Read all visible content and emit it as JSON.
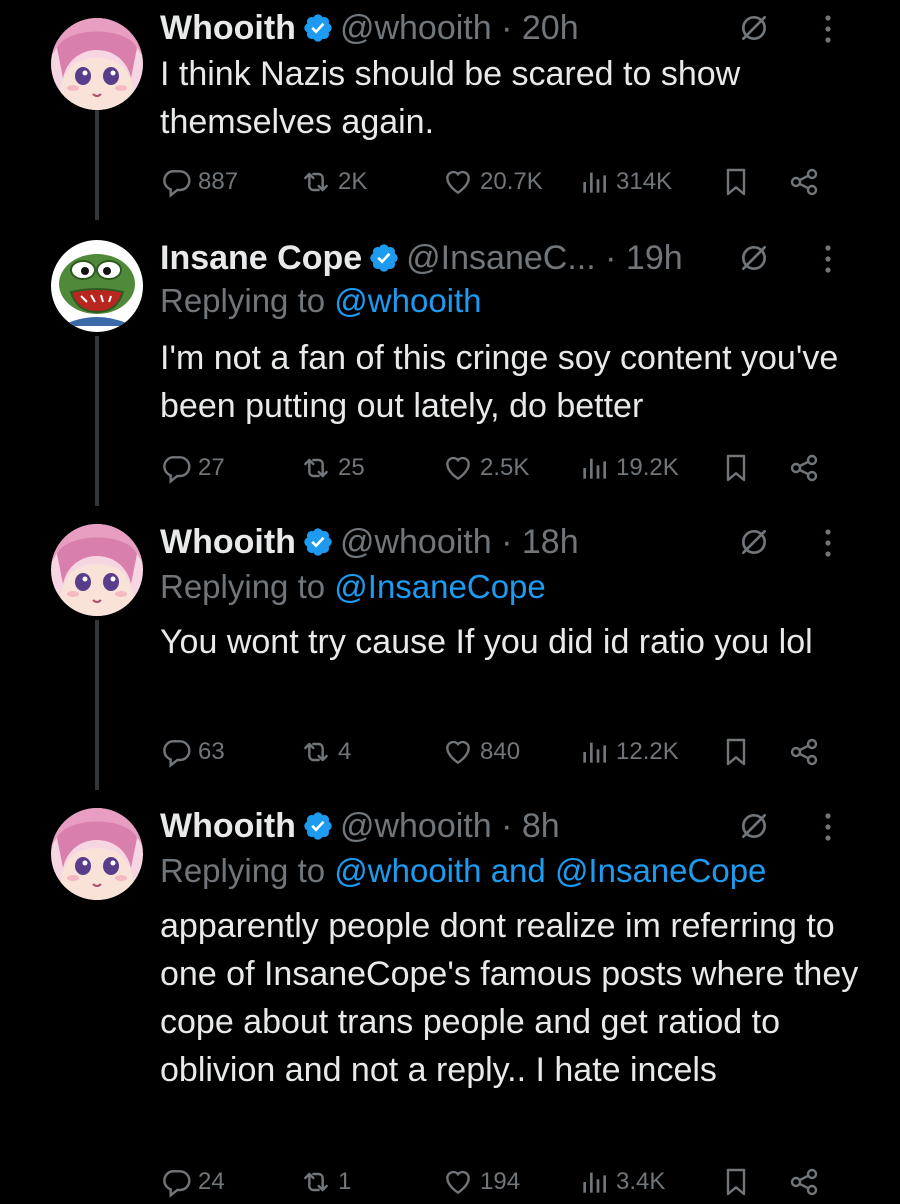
{
  "colors": {
    "background": "#000000",
    "text": "#e7e9ea",
    "muted": "#71767b",
    "link": "#1d9bf0",
    "verified": "#1d9bf0",
    "thread_line": "#333639"
  },
  "tweets": [
    {
      "name": "Whooith",
      "handle": "@whooith",
      "separator": "·",
      "time": "20h",
      "replying_label": "",
      "mentions": [],
      "text": "I think Nazis should be scared to show themselves again.",
      "stats": {
        "replies": "887",
        "reposts": "2K",
        "likes": "20.7K",
        "views": "314K"
      },
      "avatar": "anime-girl-avatar"
    },
    {
      "name": "Insane Cope",
      "handle": "@InsaneC...",
      "separator": "·",
      "time": "19h",
      "replying_label": "Replying to",
      "mentions": [
        "@whooith"
      ],
      "text": "I'm not a fan of this cringe soy content you've been putting out lately, do better",
      "stats": {
        "replies": "27",
        "reposts": "25",
        "likes": "2.5K",
        "views": "19.2K"
      },
      "avatar": "pepe-frog-avatar"
    },
    {
      "name": "Whooith",
      "handle": "@whooith",
      "separator": "·",
      "time": "18h",
      "replying_label": "Replying to",
      "mentions": [
        "@InsaneCope"
      ],
      "text": "You wont try cause If you did id ratio you lol",
      "stats": {
        "replies": "63",
        "reposts": "4",
        "likes": "840",
        "views": "12.2K"
      },
      "avatar": "anime-girl-avatar"
    },
    {
      "name": "Whooith",
      "handle": "@whooith",
      "separator": "·",
      "time": "8h",
      "replying_label": "Replying to",
      "mentions": [
        "@whooith",
        "and",
        "@InsaneCope"
      ],
      "text": "apparently people dont realize im referring to one of InsaneCope's famous posts where they cope about trans people and get ratiod to oblivion and not a reply.. I hate incels",
      "stats": {
        "replies": "24",
        "reposts": "1",
        "likes": "194",
        "views": "3.4K"
      },
      "avatar": "anime-girl-avatar"
    }
  ]
}
